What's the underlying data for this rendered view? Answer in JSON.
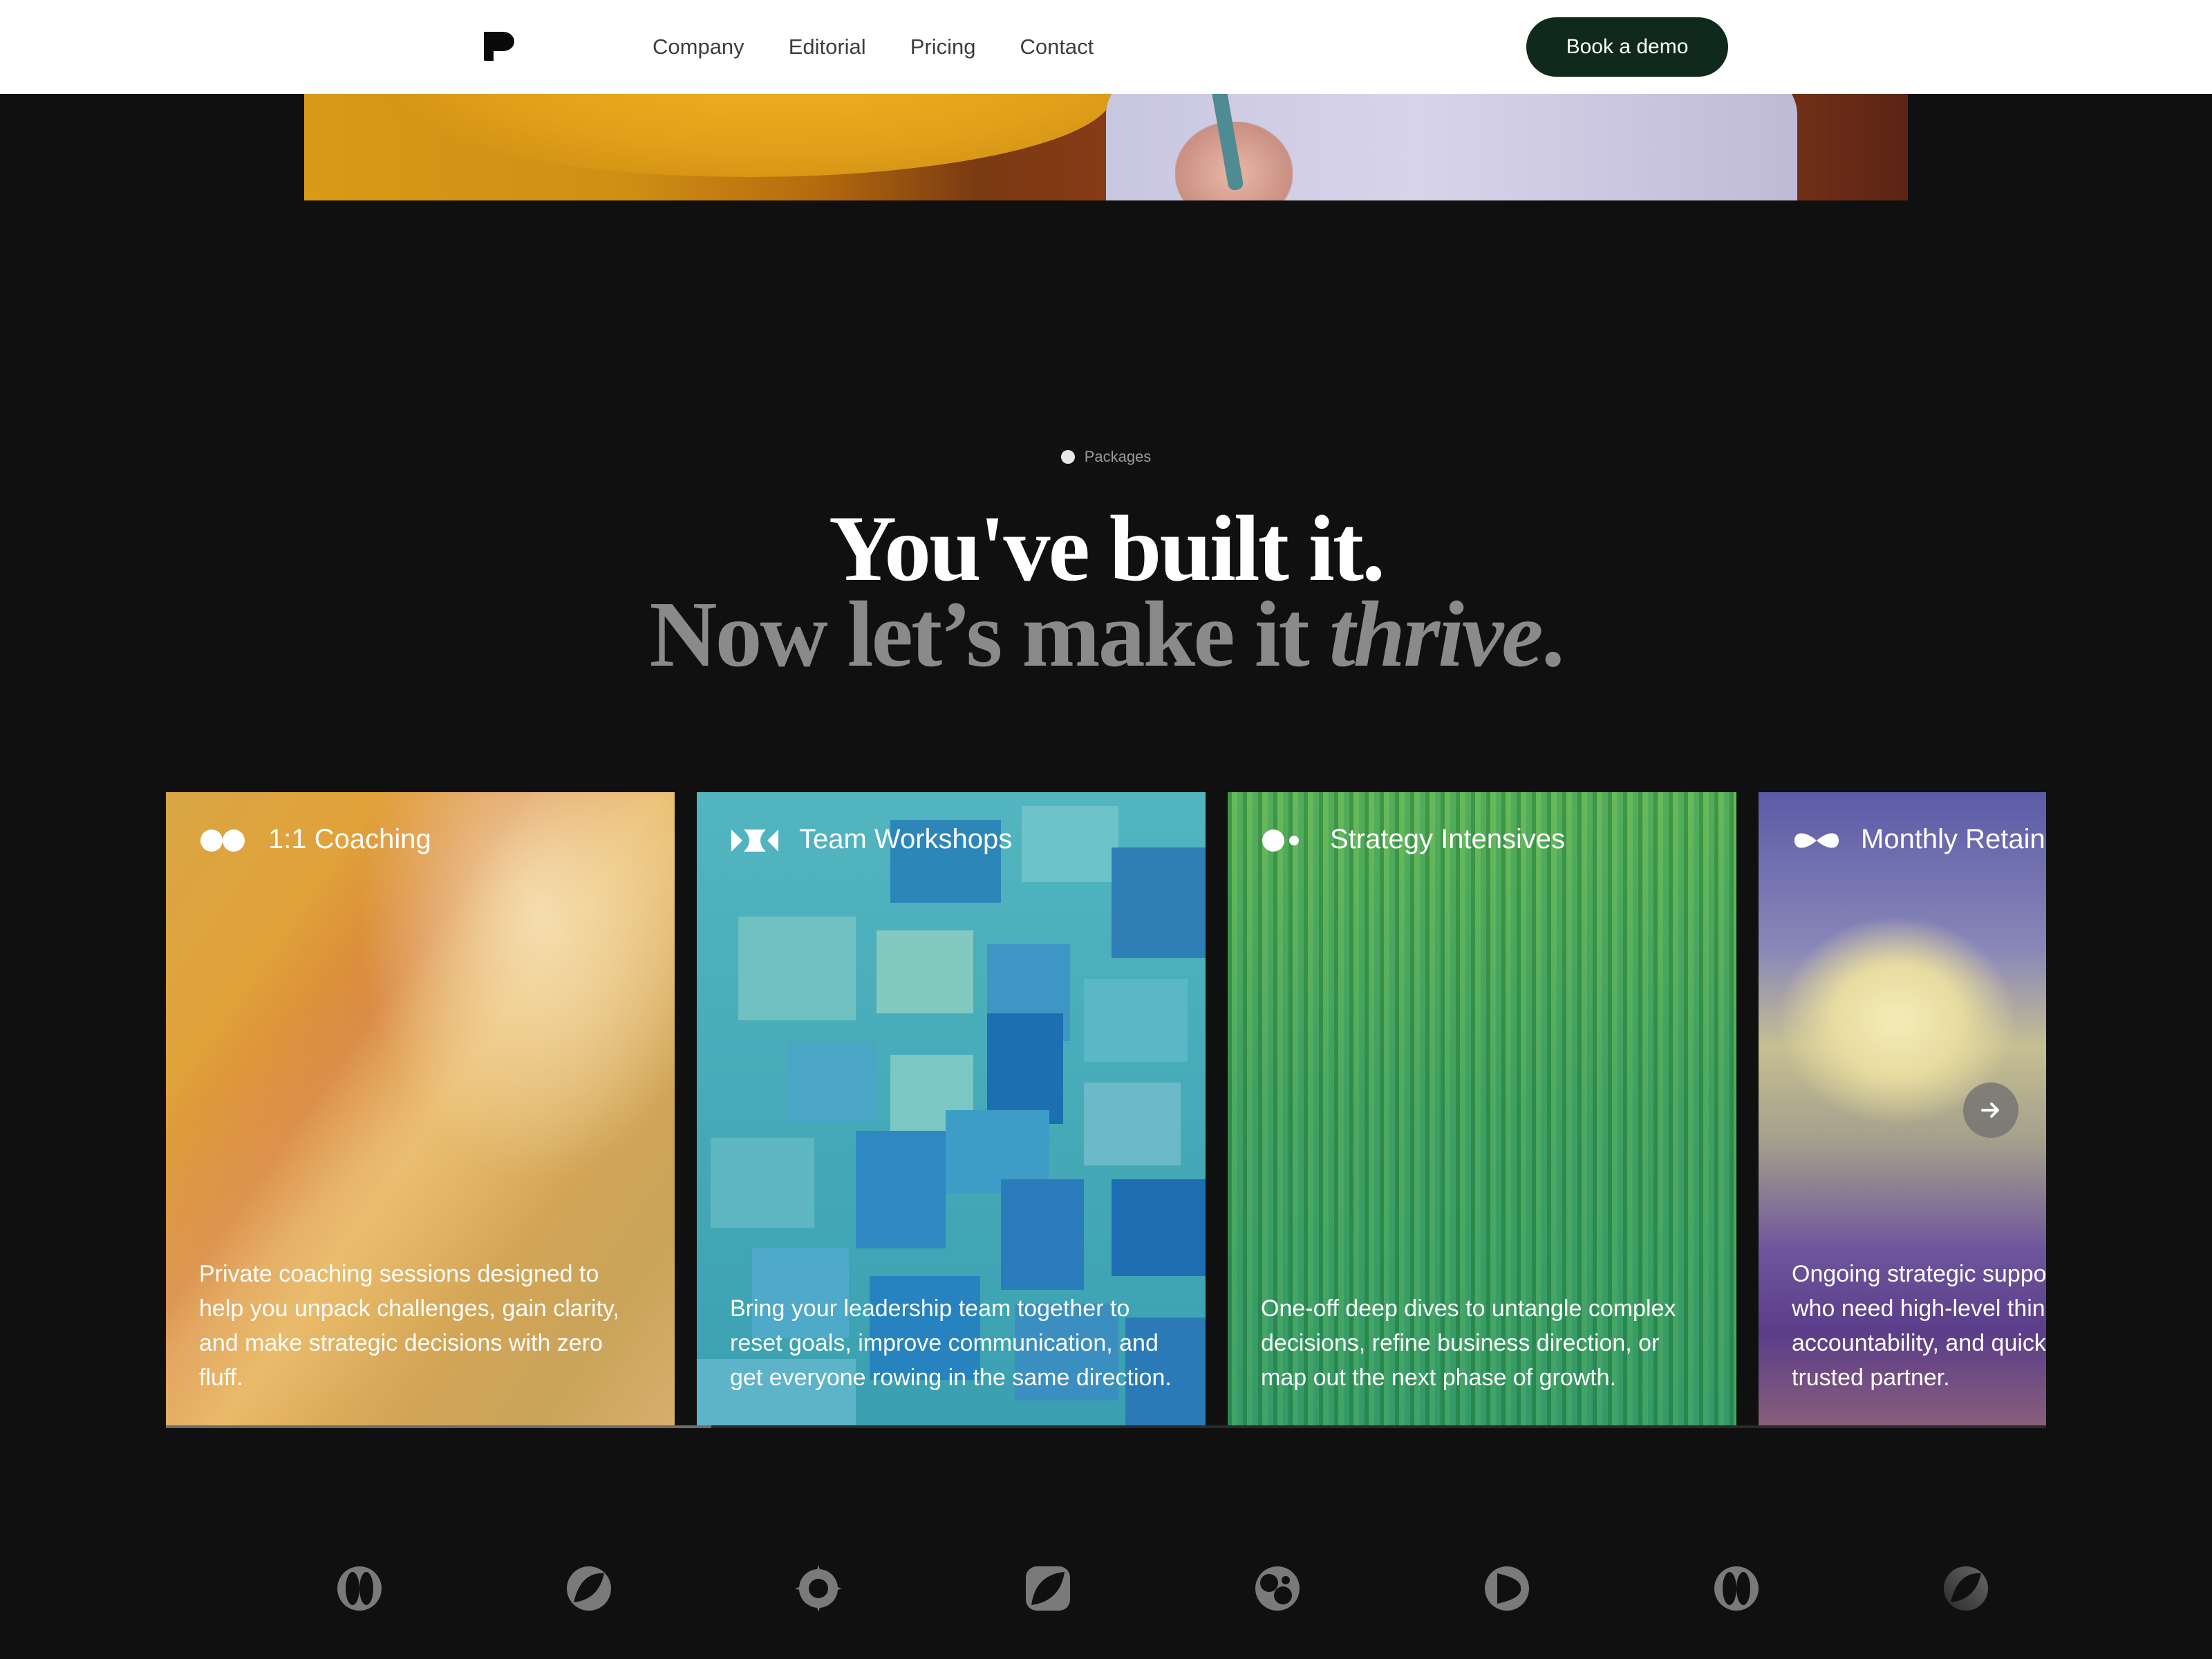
{
  "nav": {
    "logo_icon": "brand-mark-icon",
    "links": [
      "Company",
      "Editorial",
      "Pricing",
      "Contact"
    ],
    "cta_label": "Book a demo",
    "cta_color": "#0f2a1d"
  },
  "section": {
    "eyebrow": "Packages",
    "headline_line1": "You've built it.",
    "headline_line2_prefix": "Now let’s make it ",
    "headline_line2_em": "thrive",
    "headline_line2_suffix": "."
  },
  "packages": [
    {
      "title": "1:1 Coaching",
      "icon": "two-circles-icon",
      "description": "Private coaching sessions designed to help you unpack challenges, gain clarity, and make strategic decisions with zero fluff."
    },
    {
      "title": "Team Workshops",
      "icon": "bowtie-shapes-icon",
      "description": "Bring your leadership team together to reset goals, improve communication, and get everyone rowing in the same direction."
    },
    {
      "title": "Strategy Intensives",
      "icon": "circle-and-dot-icon",
      "description": "One-off deep dives to untangle complex decisions, refine business direction, or map out the next phase of growth."
    },
    {
      "title": "Monthly Retainer",
      "icon": "infinity-icon",
      "description": "Ongoing strategic support for founders who need high-level thinking, accountability, and quick access to a trusted partner."
    }
  ],
  "carousel": {
    "next_icon": "arrow-right-icon",
    "progress": 0.29
  },
  "partner_logos": [
    "split-circle-logo",
    "slash-circle-logo",
    "diamond-circle-logo",
    "rounded-square-logo",
    "bubble-circle-logo",
    "play-circle-logo",
    "split-circle-logo",
    "faded-slash-circle-logo"
  ]
}
